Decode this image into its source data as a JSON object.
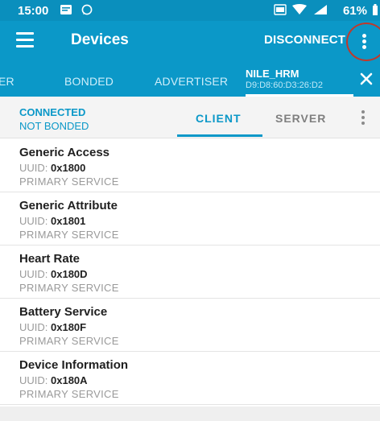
{
  "status_bar": {
    "time": "15:00",
    "battery_percent": "61%",
    "icons": [
      "notification-icon",
      "whatsapp-icon",
      "data-saver-icon",
      "wifi-icon",
      "signal-icon",
      "battery-icon"
    ]
  },
  "app_bar": {
    "title": "Devices",
    "disconnect_label": "DISCONNECT",
    "menu_icon": "hamburger-menu-icon",
    "overflow_icon": "more-vertical-icon"
  },
  "tabs": {
    "items": [
      {
        "label": "ER"
      },
      {
        "label": "BONDED"
      },
      {
        "label": "ADVERTISER"
      }
    ],
    "device": {
      "name": "NILE_HRM",
      "address": "D9:D8:60:D3:26:D2"
    },
    "close_icon": "close-icon"
  },
  "connection": {
    "state": "CONNECTED",
    "bond_state": "NOT BONDED",
    "subtabs": [
      {
        "label": "CLIENT"
      },
      {
        "label": "SERVER"
      }
    ],
    "active_subtab": "CLIENT"
  },
  "services": [
    {
      "name": "Generic Access",
      "uuid_label": "UUID:",
      "uuid": "0x1800",
      "type": "PRIMARY SERVICE"
    },
    {
      "name": "Generic Attribute",
      "uuid_label": "UUID:",
      "uuid": "0x1801",
      "type": "PRIMARY SERVICE"
    },
    {
      "name": "Heart Rate",
      "uuid_label": "UUID:",
      "uuid": "0x180D",
      "type": "PRIMARY SERVICE"
    },
    {
      "name": "Battery Service",
      "uuid_label": "UUID:",
      "uuid": "0x180F",
      "type": "PRIMARY SERVICE"
    },
    {
      "name": "Device Information",
      "uuid_label": "UUID:",
      "uuid": "0x180A",
      "type": "PRIMARY SERVICE"
    }
  ],
  "colors": {
    "primary": "#0b98c8",
    "status_bar": "#0a8fbd",
    "highlight_circle": "#c0392b"
  }
}
